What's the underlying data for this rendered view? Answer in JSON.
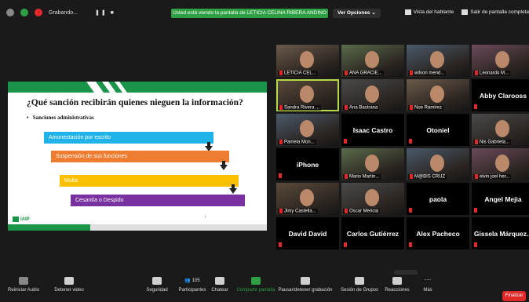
{
  "topbar": {
    "recording_label": "Grabando...",
    "banner": "Usted está viendo la pantalla de LETICIA CELINA RIBERA ANDINO",
    "view_options": "Ver Opciones",
    "speaker_view": "Vista del hablante",
    "exit_fullscreen": "Salir de pantalla completa"
  },
  "slide": {
    "title": "¿Qué sanción recibirán quienes nieguen la información?",
    "bullet": "Sanciones administrativas",
    "steps": [
      {
        "label": "Amonestación por escrito",
        "color": "#1fb3ea"
      },
      {
        "label": "Suspensión de sus funciones",
        "color": "#ee7d31"
      },
      {
        "label": "Multa",
        "color": "#fcc000"
      },
      {
        "label": "Cesantía o Despido",
        "color": "#7930a0"
      }
    ],
    "logo": "IAIP"
  },
  "participants": [
    {
      "name": "LETICIA CEL...",
      "type": "video"
    },
    {
      "name": "ANA GRACIE...",
      "type": "video"
    },
    {
      "name": "wilson mend...",
      "type": "video"
    },
    {
      "name": "Leonardo M...",
      "type": "video"
    },
    {
      "name": "Sandra Rivera ...",
      "type": "video",
      "active": true
    },
    {
      "name": "Ana Bastrana",
      "type": "video"
    },
    {
      "name": "Noe Ramirez",
      "type": "video"
    },
    {
      "name": "Abby Clarooss",
      "type": "name"
    },
    {
      "name": "Pamela Mon...",
      "type": "video"
    },
    {
      "name": "Isaac Castro",
      "type": "name"
    },
    {
      "name": "Otoniel",
      "type": "name"
    },
    {
      "name": "Nis Gabriela...",
      "type": "video"
    },
    {
      "name": "iPhone",
      "type": "name"
    },
    {
      "name": "Mario Martin...",
      "type": "video"
    },
    {
      "name": "M@BIS CRUZ",
      "type": "video"
    },
    {
      "name": "elvin joel her...",
      "type": "video"
    },
    {
      "name": "Jimy Castella...",
      "type": "video"
    },
    {
      "name": "Oscar Mericia",
      "type": "video"
    },
    {
      "name": "paola",
      "type": "name"
    },
    {
      "name": "Angel Mejia",
      "type": "name"
    },
    {
      "name": "David David",
      "type": "name"
    },
    {
      "name": "Carlos Gutiérrez",
      "type": "name"
    },
    {
      "name": "Alex Pacheco",
      "type": "name"
    },
    {
      "name": "Gissela Márquez...",
      "type": "name"
    }
  ],
  "bottombar": {
    "unmute": "Reiniciar Audio",
    "stop_video": "Detener video",
    "security": "Seguridad",
    "participants": "Participantes",
    "participants_count": "105",
    "chat": "Chatear",
    "share": "Compartir pantalla",
    "pause_recording": "Pausar/detener grabación",
    "breakout": "Sesión de Grupos",
    "reactions": "Reacciones",
    "more": "Más",
    "end": "Finalizar"
  }
}
